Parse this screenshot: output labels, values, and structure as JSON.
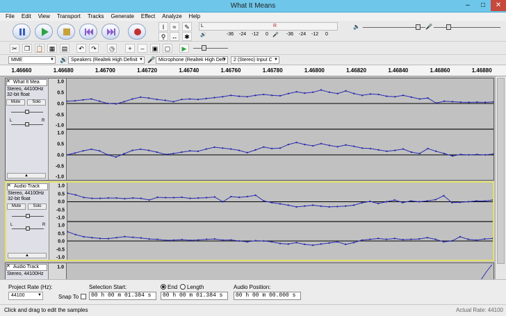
{
  "window": {
    "title": "What It Means"
  },
  "menu": [
    "File",
    "Edit",
    "View",
    "Transport",
    "Tracks",
    "Generate",
    "Effect",
    "Analyze",
    "Help"
  ],
  "transport": {
    "buttons": [
      "pause",
      "play",
      "stop",
      "skip-start",
      "skip-end",
      "record"
    ]
  },
  "meters": {
    "left_label": "L",
    "right_label": "R",
    "scale": [
      "-36",
      "-24",
      "-12",
      "0"
    ]
  },
  "device": {
    "host": "MME",
    "output": "Speakers (Realtek High Definit",
    "input": "Microphone (Realtek High Defi",
    "channels": "2 (Stereo) Input C"
  },
  "ruler": [
    "1.46660",
    "1.46680",
    "1.46700",
    "1.46720",
    "1.46740",
    "1.46760",
    "1.46780",
    "1.46800",
    "1.46820",
    "1.46840",
    "1.46860",
    "1.46880"
  ],
  "tracks": [
    {
      "name": "What It Mea",
      "rate": "Stereo, 44100Hz",
      "format": "32-bit float",
      "mute": "Mute",
      "solo": "Solo",
      "l": "L",
      "r": "R",
      "scale_top": [
        "1.0",
        "0.5",
        "0.0",
        "-0.5",
        "-1.0"
      ],
      "scale_bottom": [
        "1.0",
        "0.5",
        "0.0",
        "-0.5",
        "-1.0"
      ]
    },
    {
      "name": "Audio Track",
      "rate": "Stereo, 44100Hz",
      "format": "32-bit float",
      "mute": "Mute",
      "solo": "Solo",
      "l": "L",
      "r": "R",
      "scale_top": [
        "1.0",
        "0.5",
        "0.0",
        "-0.5",
        "-1.0"
      ],
      "scale_bottom": [
        "1.0",
        "0.5",
        "0.0",
        "-0.5",
        "-1.0"
      ]
    },
    {
      "name": "Audio Track",
      "rate": "Stereo, 44100Hz",
      "scale_top": [
        "1.0"
      ]
    }
  ],
  "waves": {
    "t1a": [
      0.1,
      0.12,
      0.16,
      0.2,
      0.1,
      0.0,
      -0.02,
      0.08,
      0.2,
      0.28,
      0.24,
      0.18,
      0.14,
      0.08,
      0.18,
      0.2,
      0.18,
      0.22,
      0.26,
      0.3,
      0.36,
      0.32,
      0.3,
      0.36,
      0.4,
      0.36,
      0.34,
      0.44,
      0.52,
      0.46,
      0.5,
      0.6,
      0.5,
      0.44,
      0.56,
      0.44,
      0.36,
      0.42,
      0.4,
      0.32,
      0.3,
      0.36,
      0.28,
      0.2,
      0.24,
      0.02,
      0.1,
      0.08,
      0.06,
      0.05,
      0.06,
      0.05,
      0.07
    ],
    "t1b": [
      0.0,
      0.08,
      0.18,
      0.25,
      0.18,
      0.0,
      -0.1,
      0.05,
      0.2,
      0.25,
      0.2,
      0.12,
      0.02,
      0.06,
      0.12,
      0.18,
      0.16,
      0.26,
      0.34,
      0.3,
      0.26,
      0.2,
      0.1,
      0.22,
      0.35,
      0.28,
      0.3,
      0.46,
      0.55,
      0.46,
      0.4,
      0.5,
      0.42,
      0.36,
      0.44,
      0.38,
      0.3,
      0.28,
      0.22,
      0.16,
      0.2,
      0.26,
      0.12,
      0.06,
      0.28,
      0.16,
      0.06,
      -0.05,
      0.02,
      0.0,
      0.02,
      0.0,
      0.04
    ],
    "t2a": [
      0.5,
      0.4,
      0.25,
      0.2,
      0.2,
      0.22,
      0.22,
      0.18,
      0.22,
      0.2,
      0.1,
      0.26,
      0.24,
      0.24,
      0.26,
      0.2,
      0.22,
      0.24,
      0.28,
      0.0,
      0.3,
      0.26,
      0.3,
      0.38,
      0.05,
      -0.05,
      -0.12,
      -0.2,
      -0.3,
      -0.25,
      -0.2,
      -0.26,
      -0.3,
      -0.28,
      -0.25,
      -0.2,
      -0.06,
      0.02,
      -0.1,
      0.0,
      0.1,
      -0.05,
      0.05,
      0.0,
      0.05,
      0.12,
      0.35,
      -0.05,
      -0.03,
      0.0,
      0.05,
      0.04,
      0.1
    ],
    "t2b": [
      0.55,
      0.38,
      0.25,
      0.2,
      0.15,
      0.14,
      0.2,
      0.26,
      0.22,
      0.18,
      0.12,
      0.1,
      0.04,
      0.05,
      0.08,
      0.04,
      0.06,
      0.1,
      0.12,
      0.05,
      0.06,
      0.0,
      -0.05,
      0.02,
      0.0,
      -0.05,
      -0.15,
      -0.18,
      -0.1,
      -0.2,
      -0.25,
      -0.18,
      -0.12,
      -0.05,
      -0.2,
      -0.1,
      0.05,
      0.1,
      0.15,
      0.1,
      0.15,
      0.08,
      0.1,
      0.12,
      0.2,
      0.1,
      -0.05,
      0.0,
      0.25,
      0.1,
      0.05,
      0.12,
      0.15
    ]
  },
  "selection": {
    "project_rate_label": "Project Rate (Hz):",
    "project_rate": "44100",
    "snap_label": "Snap To",
    "sel_start_label": "Selection Start:",
    "end_label": "End",
    "length_label": "Length",
    "start": "00 h 00 m 01.384 s",
    "end": "00 h 00 m 01.384 s",
    "audio_pos_label": "Audio Position:",
    "audio_pos": "00 h 00 m 00.000 s"
  },
  "status": {
    "text": "Click and drag to edit the samples",
    "right": "Actual Rate: 44100"
  }
}
